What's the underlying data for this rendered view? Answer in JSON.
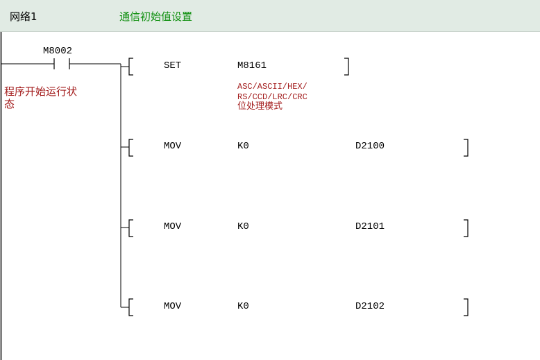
{
  "network": {
    "label": "网络1",
    "comment": "通信初始值设置"
  },
  "contact": {
    "address": "M8002",
    "comment_line1": "程序开始运行状",
    "comment_line2": "态"
  },
  "rungs": [
    {
      "instruction": "SET",
      "operand1": "M8161",
      "operand2": "",
      "comment_lines": [
        "ASC/ASCII/HEX/",
        "RS/CCD/LRC/CRC",
        "位处理模式"
      ]
    },
    {
      "instruction": "MOV",
      "operand1": "K0",
      "operand2": "D2100",
      "comment_lines": []
    },
    {
      "instruction": "MOV",
      "operand1": "K0",
      "operand2": "D2101",
      "comment_lines": []
    },
    {
      "instruction": "MOV",
      "operand1": "K0",
      "operand2": "D2102",
      "comment_lines": []
    }
  ],
  "colors": {
    "header_bg": "#e1ebe4",
    "comment_green": "#109010",
    "annotation_red": "#a21a1a",
    "wire": "#000000"
  }
}
